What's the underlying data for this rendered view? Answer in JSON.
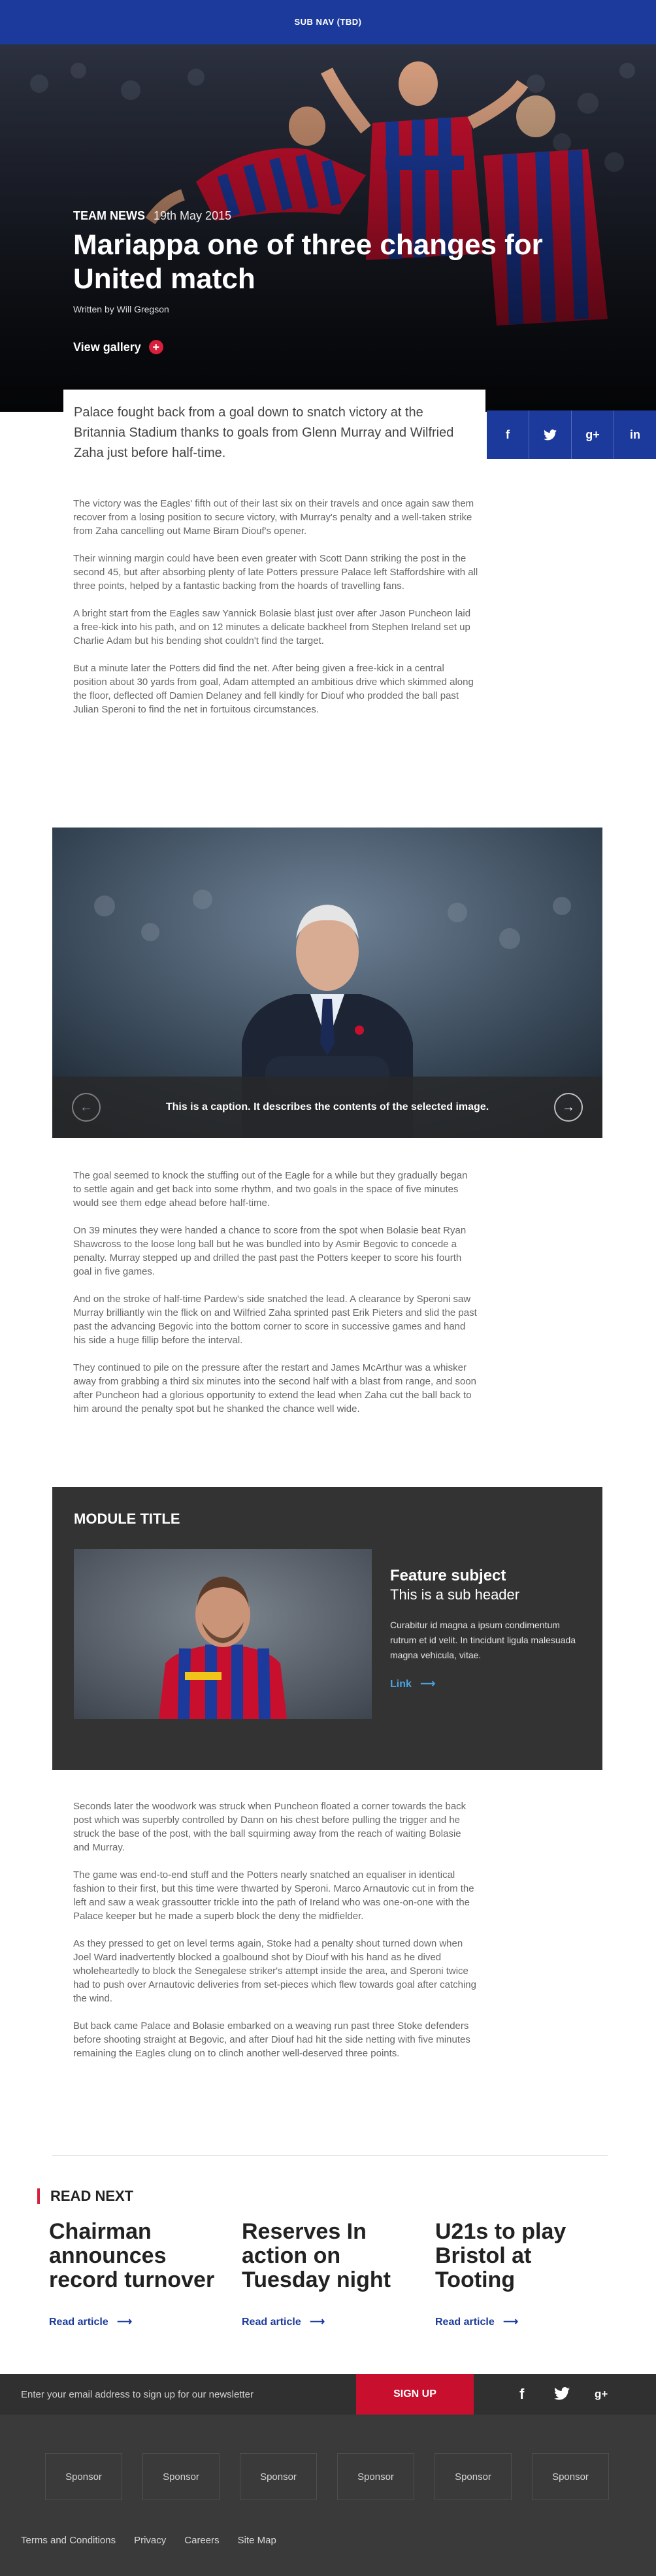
{
  "subnav": {
    "label": "SUB NAV (TBD)"
  },
  "hero": {
    "category": "TEAM NEWS",
    "date": "19th May 2015",
    "headline": "Mariappa one of three changes for United match",
    "byline": "Written by Will Gregson",
    "gallery_label": "View gallery",
    "gallery_icon": "plus-icon"
  },
  "intro": "Palace fought back from a goal down to snatch victory at the Britannia Stadium thanks to goals from Glenn Murray and Wilfried Zaha just before half-time.",
  "share": {
    "icons": [
      "facebook-icon",
      "twitter-icon",
      "google-plus-icon",
      "linkedin-icon"
    ],
    "labels": [
      "f",
      "",
      "g+",
      "in"
    ]
  },
  "article_part1": [
    "The victory was the Eagles' fifth out of their last six on their travels and once again saw them recover from a losing position to secure victory, with Murray's penalty and a well-taken strike from Zaha cancelling out Mame Biram Diouf's opener.",
    "Their winning margin could have been even greater with Scott Dann striking the post in the second 45, but after absorbing plenty of late Potters pressure Palace left Staffordshire with all three points, helped by a fantastic backing from the hoards of travelling fans.",
    "A bright start from the Eagles saw Yannick Bolasie blast just over after Jason Puncheon laid a free-kick into his path, and on 12 minutes a delicate backheel from Stephen Ireland set up Charlie Adam but his bending shot couldn't find the target.",
    "But a minute later the Potters did find the net. After being given a free-kick in a central position about 30 yards from goal, Adam attempted an ambitious drive which skimmed along the floor, deflected off Damien Delaney and fell kindly for Diouf who prodded the ball past Julian Speroni to find the net in fortuitous circumstances."
  ],
  "gallery": {
    "caption": "This is a caption. It describes the contents of the selected image.",
    "prev_icon": "arrow-left-icon",
    "next_icon": "arrow-right-icon"
  },
  "article_part2": [
    "The goal seemed to knock the stuffing out of the Eagle for a while but they gradually began to settle again and get back into some rhythm, and two goals in the space of five minutes would see them edge ahead before half-time.",
    "On 39 minutes they were handed a chance to score from the spot when Bolasie beat Ryan Shawcross to the loose long ball but he was bundled into by Asmir Begovic to concede a penalty. Murray stepped up and drilled the past past the Potters keeper to score his fourth goal in five games.",
    "And on the stroke of half-time Pardew's side snatched the lead. A clearance by Speroni saw Murray brilliantly win the flick on and Wilfried Zaha sprinted past Erik Pieters and slid the past past the advancing Begovic into the bottom corner to score in successive games and hand his side a huge fillip before the interval.",
    "They continued to pile on the pressure after the restart and James McArthur was a whisker away from grabbing a third six minutes into the second half with a blast from range, and soon after Puncheon had a glorious opportunity to extend the lead when Zaha cut the ball back to him around the penalty spot but he shanked the chance well wide."
  ],
  "module": {
    "title": "MODULE TITLE",
    "feature_subject": "Feature subject",
    "feature_subheader": "This is a sub header",
    "description": "Curabitur id magna a ipsum condimentum rutrum et id velit. In tincidunt ligula malesuada magna vehicula, vitae.",
    "link_label": "Link",
    "link_icon": "arrow-right-icon"
  },
  "article_part3": [
    "Seconds later the woodwork was struck when Puncheon floated a corner towards the back post which was superbly controlled by Dann on his chest before pulling the trigger and he struck the base of the post, with the ball squirming away from the reach of waiting Bolasie and Murray.",
    "The game was end-to-end stuff and the Potters nearly snatched an equaliser in identical fashion to their first, but this time were thwarted by Speroni. Marco Arnautovic cut in from the left and saw a weak grassoutter trickle into the path of Ireland who was one-on-one with the Palace keeper but he made a superb block the deny the midfielder.",
    "As they pressed to get on level terms again, Stoke had a penalty shout turned down when Joel Ward inadvertently blocked a goalbound shot by Diouf with his hand as he dived wholeheartedly to block the Senegalese striker's attempt inside the area, and Speroni twice had to push over Arnautovic deliveries from set-pieces which flew towards goal after catching the wind.",
    "But back came Palace and Bolasie embarked on a weaving run past three Stoke defenders before shooting straight at Begovic, and after Diouf had hit the side netting with five minutes remaining the Eagles clung on to clinch another well-deserved three points."
  ],
  "read_next": {
    "heading": "READ NEXT",
    "cards": [
      {
        "title": "Chairman announces record turnover",
        "link": "Read article"
      },
      {
        "title": "Reserves In action on Tuesday night",
        "link": "Read article"
      },
      {
        "title": "U21s to play Bristol at Tooting",
        "link": "Read article"
      }
    ]
  },
  "newsletter": {
    "placeholder": "Enter your email address to sign up for our newsletter",
    "button": "SIGN UP",
    "social_icons": [
      "facebook-icon",
      "twitter-icon",
      "google-plus-icon"
    ]
  },
  "footer": {
    "sponsors": [
      "Sponsor",
      "Sponsor",
      "Sponsor",
      "Sponsor",
      "Sponsor",
      "Sponsor"
    ],
    "links": [
      "Terms and Conditions",
      "Privacy",
      "Careers",
      "Site Map"
    ]
  },
  "colors": {
    "brand_blue": "#1b3a9c",
    "accent_red": "#d81f3b",
    "link_blue": "#4aa3e0",
    "module_bg": "#333333",
    "footer_bg": "#3a3a3a"
  }
}
